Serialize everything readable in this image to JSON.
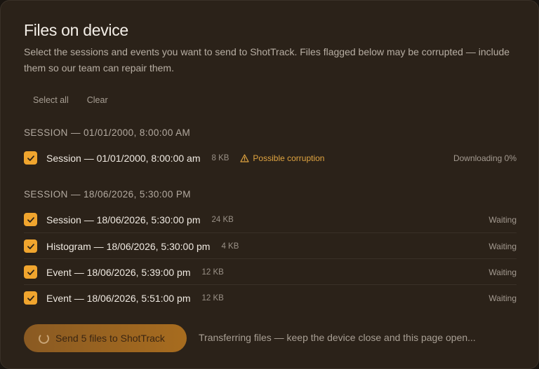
{
  "dialog": {
    "title": "Files on device",
    "description": "Select the sessions and events you want to send to ShotTrack. Files flagged below may be corrupted — include them so our team can repair them."
  },
  "actions": {
    "select_all": "Select all",
    "clear": "Clear"
  },
  "groups": [
    {
      "header": "SESSION — 01/01/2000, 8:00:00 AM",
      "items": [
        {
          "label": "Session — 01/01/2000, 8:00:00 am",
          "size": "8 KB",
          "warning": "Possible corruption",
          "status": "Downloading 0%",
          "checked": true
        }
      ]
    },
    {
      "header": "SESSION — 18/06/2026, 5:30:00 PM",
      "items": [
        {
          "label": "Session — 18/06/2026, 5:30:00 pm",
          "size": "24 KB",
          "status": "Waiting",
          "checked": true
        },
        {
          "label": "Histogram — 18/06/2026, 5:30:00 pm",
          "size": "4 KB",
          "status": "Waiting",
          "checked": true
        },
        {
          "label": "Event — 18/06/2026, 5:39:00 pm",
          "size": "12 KB",
          "status": "Waiting",
          "checked": true
        },
        {
          "label": "Event — 18/06/2026, 5:51:00 pm",
          "size": "12 KB",
          "status": "Waiting",
          "checked": true
        }
      ]
    }
  ],
  "footer": {
    "send_label": "Send 5 files to ShotTrack",
    "transfer_note": "Transferring files — keep the device close and this page open..."
  },
  "colors": {
    "accent": "#f0a52e",
    "warning": "#e0a440",
    "background": "#2b2219"
  },
  "icons": {
    "checkbox": "check-icon",
    "warning": "warning-triangle-icon",
    "spinner": "spinner-icon"
  }
}
